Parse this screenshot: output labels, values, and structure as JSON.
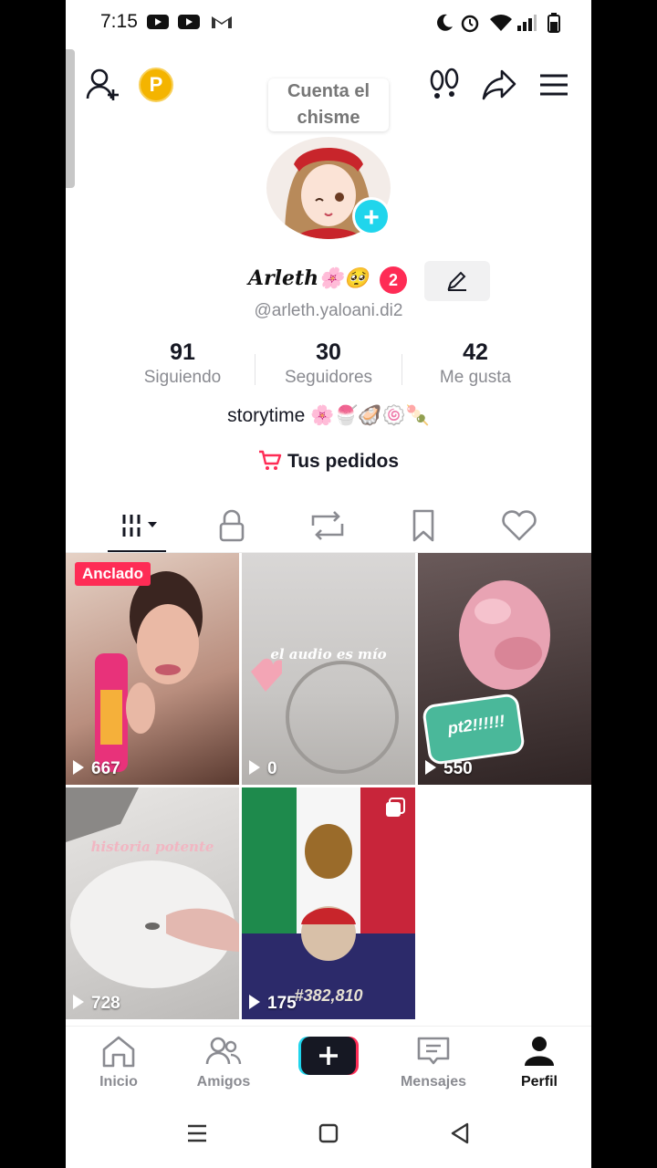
{
  "status_bar": {
    "time": "7:15"
  },
  "header": {
    "tooltip": "Cuenta el chisme",
    "coins_badge": "P"
  },
  "profile": {
    "display_name": "Arleth🌸🥺",
    "notification_count": "2",
    "username": "@arleth.yaloani.di2",
    "stats": [
      {
        "value": "91",
        "label": "Siguiendo"
      },
      {
        "value": "30",
        "label": "Seguidores"
      },
      {
        "value": "42",
        "label": "Me gusta"
      }
    ],
    "bio": "storytime 🌸🍧🦪🍥🍡",
    "orders_label": "Tus pedidos"
  },
  "tabs": [
    "videos-icon",
    "lock-icon",
    "repost-icon",
    "bookmark-icon",
    "heart-icon"
  ],
  "videos": [
    {
      "views": "667",
      "pinned_label": "Anclado"
    },
    {
      "views": "0",
      "overlay": "el audio es mío"
    },
    {
      "views": "550",
      "overlay": "pt2!!!!!!"
    },
    {
      "views": "728",
      "overlay": "historia potente"
    },
    {
      "views": "175",
      "overlay": "#382,810"
    }
  ],
  "bottom_nav": [
    {
      "label": "Inicio"
    },
    {
      "label": "Amigos"
    },
    {
      "label": ""
    },
    {
      "label": "Mensajes"
    },
    {
      "label": "Perfil"
    }
  ],
  "colors": {
    "accent": "#fe2c55",
    "cyan": "#20d5ec",
    "text": "#161823",
    "muted": "#8a8b91"
  }
}
